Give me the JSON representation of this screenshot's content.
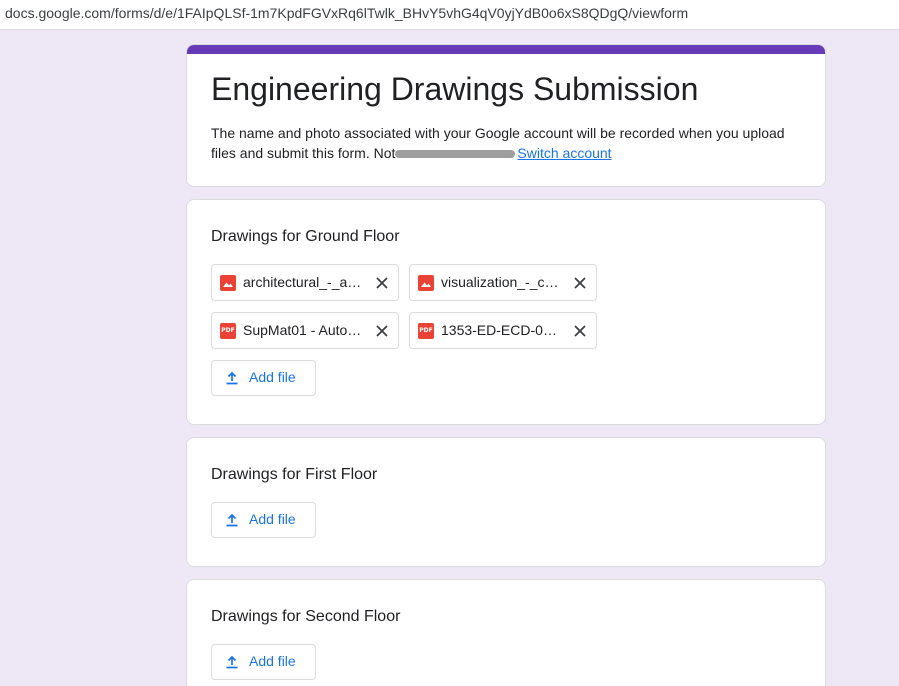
{
  "browser": {
    "url": "docs.google.com/forms/d/e/1FAIpQLSf-1m7KpdFGVxRq6lTwlk_BHvY5vhG4qV0yjYdB0o6xS8QDgQ/viewform"
  },
  "form": {
    "title": "Engineering Drawings Submission",
    "description_part1": "The name and photo associated with your Google account will be recorded when you upload files and submit this form. Not",
    "switch_account": "Switch account",
    "accent_color": "#673ab7",
    "background_color": "#ede7f6",
    "link_color": "#1a73e8"
  },
  "questions": [
    {
      "title": "Drawings for Ground Floor",
      "files": [
        {
          "name": "architectural_-_a…",
          "icon": "image-file-icon"
        },
        {
          "name": "visualization_-_c…",
          "icon": "image-file-icon"
        },
        {
          "name": "SupMat01 - Auto…",
          "icon": "pdf-file-icon"
        },
        {
          "name": "1353-ED-ECD-01…",
          "icon": "pdf-file-icon"
        }
      ],
      "add_file_label": "Add file"
    },
    {
      "title": "Drawings for First Floor",
      "files": [],
      "add_file_label": "Add file"
    },
    {
      "title": "Drawings for Second Floor",
      "files": [],
      "add_file_label": "Add file"
    }
  ],
  "icons": {
    "pdf_label": "PDF"
  }
}
